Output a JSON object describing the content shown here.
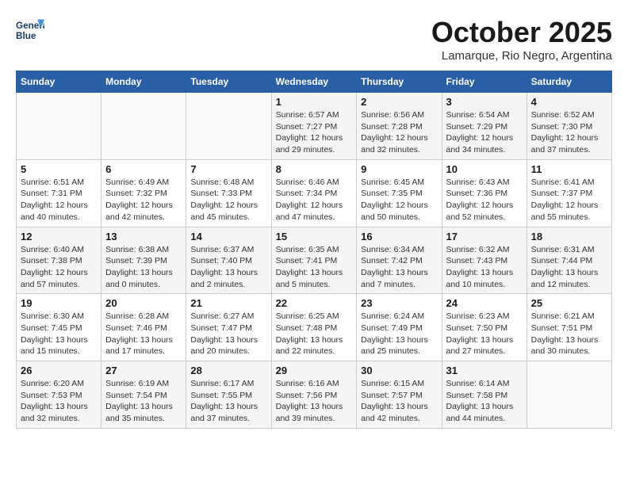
{
  "header": {
    "logo_line1": "General",
    "logo_line2": "Blue",
    "month": "October 2025",
    "location": "Lamarque, Rio Negro, Argentina"
  },
  "weekdays": [
    "Sunday",
    "Monday",
    "Tuesday",
    "Wednesday",
    "Thursday",
    "Friday",
    "Saturday"
  ],
  "weeks": [
    [
      {
        "day": "",
        "info": ""
      },
      {
        "day": "",
        "info": ""
      },
      {
        "day": "",
        "info": ""
      },
      {
        "day": "1",
        "info": "Sunrise: 6:57 AM\nSunset: 7:27 PM\nDaylight: 12 hours and 29 minutes."
      },
      {
        "day": "2",
        "info": "Sunrise: 6:56 AM\nSunset: 7:28 PM\nDaylight: 12 hours and 32 minutes."
      },
      {
        "day": "3",
        "info": "Sunrise: 6:54 AM\nSunset: 7:29 PM\nDaylight: 12 hours and 34 minutes."
      },
      {
        "day": "4",
        "info": "Sunrise: 6:52 AM\nSunset: 7:30 PM\nDaylight: 12 hours and 37 minutes."
      }
    ],
    [
      {
        "day": "5",
        "info": "Sunrise: 6:51 AM\nSunset: 7:31 PM\nDaylight: 12 hours and 40 minutes."
      },
      {
        "day": "6",
        "info": "Sunrise: 6:49 AM\nSunset: 7:32 PM\nDaylight: 12 hours and 42 minutes."
      },
      {
        "day": "7",
        "info": "Sunrise: 6:48 AM\nSunset: 7:33 PM\nDaylight: 12 hours and 45 minutes."
      },
      {
        "day": "8",
        "info": "Sunrise: 6:46 AM\nSunset: 7:34 PM\nDaylight: 12 hours and 47 minutes."
      },
      {
        "day": "9",
        "info": "Sunrise: 6:45 AM\nSunset: 7:35 PM\nDaylight: 12 hours and 50 minutes."
      },
      {
        "day": "10",
        "info": "Sunrise: 6:43 AM\nSunset: 7:36 PM\nDaylight: 12 hours and 52 minutes."
      },
      {
        "day": "11",
        "info": "Sunrise: 6:41 AM\nSunset: 7:37 PM\nDaylight: 12 hours and 55 minutes."
      }
    ],
    [
      {
        "day": "12",
        "info": "Sunrise: 6:40 AM\nSunset: 7:38 PM\nDaylight: 12 hours and 57 minutes."
      },
      {
        "day": "13",
        "info": "Sunrise: 6:38 AM\nSunset: 7:39 PM\nDaylight: 13 hours and 0 minutes."
      },
      {
        "day": "14",
        "info": "Sunrise: 6:37 AM\nSunset: 7:40 PM\nDaylight: 13 hours and 2 minutes."
      },
      {
        "day": "15",
        "info": "Sunrise: 6:35 AM\nSunset: 7:41 PM\nDaylight: 13 hours and 5 minutes."
      },
      {
        "day": "16",
        "info": "Sunrise: 6:34 AM\nSunset: 7:42 PM\nDaylight: 13 hours and 7 minutes."
      },
      {
        "day": "17",
        "info": "Sunrise: 6:32 AM\nSunset: 7:43 PM\nDaylight: 13 hours and 10 minutes."
      },
      {
        "day": "18",
        "info": "Sunrise: 6:31 AM\nSunset: 7:44 PM\nDaylight: 13 hours and 12 minutes."
      }
    ],
    [
      {
        "day": "19",
        "info": "Sunrise: 6:30 AM\nSunset: 7:45 PM\nDaylight: 13 hours and 15 minutes."
      },
      {
        "day": "20",
        "info": "Sunrise: 6:28 AM\nSunset: 7:46 PM\nDaylight: 13 hours and 17 minutes."
      },
      {
        "day": "21",
        "info": "Sunrise: 6:27 AM\nSunset: 7:47 PM\nDaylight: 13 hours and 20 minutes."
      },
      {
        "day": "22",
        "info": "Sunrise: 6:25 AM\nSunset: 7:48 PM\nDaylight: 13 hours and 22 minutes."
      },
      {
        "day": "23",
        "info": "Sunrise: 6:24 AM\nSunset: 7:49 PM\nDaylight: 13 hours and 25 minutes."
      },
      {
        "day": "24",
        "info": "Sunrise: 6:23 AM\nSunset: 7:50 PM\nDaylight: 13 hours and 27 minutes."
      },
      {
        "day": "25",
        "info": "Sunrise: 6:21 AM\nSunset: 7:51 PM\nDaylight: 13 hours and 30 minutes."
      }
    ],
    [
      {
        "day": "26",
        "info": "Sunrise: 6:20 AM\nSunset: 7:53 PM\nDaylight: 13 hours and 32 minutes."
      },
      {
        "day": "27",
        "info": "Sunrise: 6:19 AM\nSunset: 7:54 PM\nDaylight: 13 hours and 35 minutes."
      },
      {
        "day": "28",
        "info": "Sunrise: 6:17 AM\nSunset: 7:55 PM\nDaylight: 13 hours and 37 minutes."
      },
      {
        "day": "29",
        "info": "Sunrise: 6:16 AM\nSunset: 7:56 PM\nDaylight: 13 hours and 39 minutes."
      },
      {
        "day": "30",
        "info": "Sunrise: 6:15 AM\nSunset: 7:57 PM\nDaylight: 13 hours and 42 minutes."
      },
      {
        "day": "31",
        "info": "Sunrise: 6:14 AM\nSunset: 7:58 PM\nDaylight: 13 hours and 44 minutes."
      },
      {
        "day": "",
        "info": ""
      }
    ]
  ]
}
